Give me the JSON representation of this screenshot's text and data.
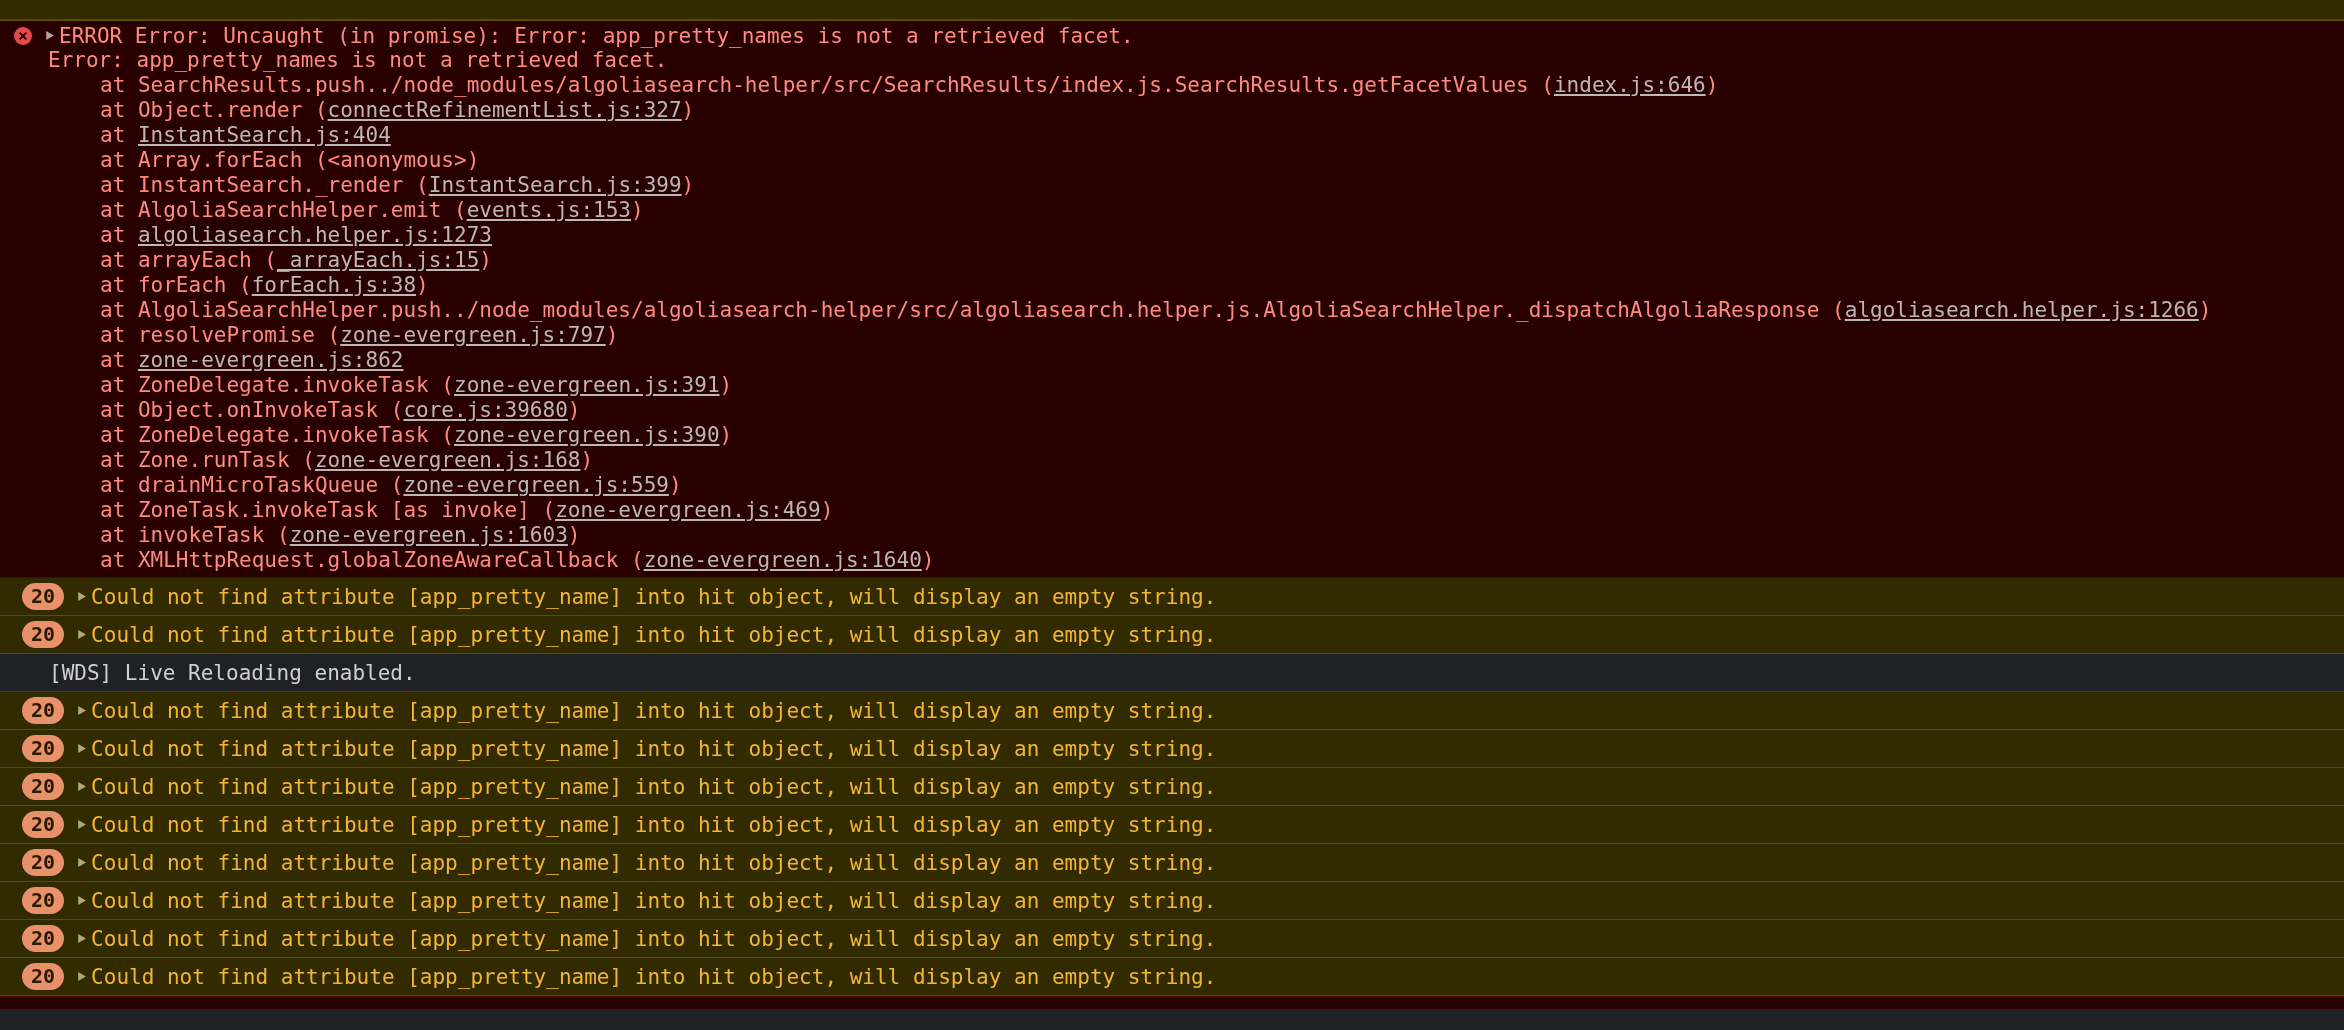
{
  "error": {
    "expanded": false,
    "title": "ERROR Error: Uncaught (in promise): Error: app_pretty_names is not a retrieved facet.",
    "message": "Error: app_pretty_names is not a retrieved facet.",
    "frames": [
      {
        "before": "at SearchResults.push../node_modules/algoliasearch-helper/src/SearchResults/index.js.SearchResults.getFacetValues (",
        "link": "index.js:646",
        "after": ")"
      },
      {
        "before": "at Object.render (",
        "link": "connectRefinementList.js:327",
        "after": ")"
      },
      {
        "before": "at ",
        "link": "InstantSearch.js:404"
      },
      {
        "before": "at Array.forEach (<anonymous>)"
      },
      {
        "before": "at InstantSearch._render (",
        "link": "InstantSearch.js:399",
        "after": ")"
      },
      {
        "before": "at AlgoliaSearchHelper.emit (",
        "link": "events.js:153",
        "after": ")"
      },
      {
        "before": "at ",
        "link": "algoliasearch.helper.js:1273"
      },
      {
        "before": "at arrayEach (",
        "link": "_arrayEach.js:15",
        "after": ")"
      },
      {
        "before": "at forEach (",
        "link": "forEach.js:38",
        "after": ")"
      },
      {
        "before": "at AlgoliaSearchHelper.push../node_modules/algoliasearch-helper/src/algoliasearch.helper.js.AlgoliaSearchHelper._dispatchAlgoliaResponse (",
        "link": "algoliasearch.helper.js:1266",
        "after": ")"
      },
      {
        "before": "at resolvePromise (",
        "link": "zone-evergreen.js:797",
        "after": ")"
      },
      {
        "before": "at ",
        "link": "zone-evergreen.js:862"
      },
      {
        "before": "at ZoneDelegate.invokeTask (",
        "link": "zone-evergreen.js:391",
        "after": ")"
      },
      {
        "before": "at Object.onInvokeTask (",
        "link": "core.js:39680",
        "after": ")"
      },
      {
        "before": "at ZoneDelegate.invokeTask (",
        "link": "zone-evergreen.js:390",
        "after": ")"
      },
      {
        "before": "at Zone.runTask (",
        "link": "zone-evergreen.js:168",
        "after": ")"
      },
      {
        "before": "at drainMicroTaskQueue (",
        "link": "zone-evergreen.js:559",
        "after": ")"
      },
      {
        "before": "at ZoneTask.invokeTask [as invoke] (",
        "link": "zone-evergreen.js:469",
        "after": ")"
      },
      {
        "before": "at invokeTask (",
        "link": "zone-evergreen.js:1603",
        "after": ")"
      },
      {
        "before": "at XMLHttpRequest.globalZoneAwareCallback (",
        "link": "zone-evergreen.js:1640",
        "after": ")"
      }
    ]
  },
  "messages": [
    {
      "kind": "warning",
      "count": "20",
      "expanded": false,
      "text": "Could not find attribute [app_pretty_name] into hit object, will display an empty string."
    },
    {
      "kind": "warning",
      "count": "20",
      "expanded": false,
      "text": "Could not find attribute [app_pretty_name] into hit object, will display an empty string."
    },
    {
      "kind": "info",
      "text": "[WDS] Live Reloading enabled."
    },
    {
      "kind": "warning",
      "count": "20",
      "expanded": false,
      "text": "Could not find attribute [app_pretty_name] into hit object, will display an empty string."
    },
    {
      "kind": "warning",
      "count": "20",
      "expanded": false,
      "text": "Could not find attribute [app_pretty_name] into hit object, will display an empty string."
    },
    {
      "kind": "warning",
      "count": "20",
      "expanded": false,
      "text": "Could not find attribute [app_pretty_name] into hit object, will display an empty string."
    },
    {
      "kind": "warning",
      "count": "20",
      "expanded": false,
      "text": "Could not find attribute [app_pretty_name] into hit object, will display an empty string."
    },
    {
      "kind": "warning",
      "count": "20",
      "expanded": false,
      "text": "Could not find attribute [app_pretty_name] into hit object, will display an empty string."
    },
    {
      "kind": "warning",
      "count": "20",
      "expanded": false,
      "text": "Could not find attribute [app_pretty_name] into hit object, will display an empty string."
    },
    {
      "kind": "warning",
      "count": "20",
      "expanded": false,
      "text": "Could not find attribute [app_pretty_name] into hit object, will display an empty string."
    },
    {
      "kind": "warning",
      "count": "20",
      "expanded": false,
      "text": "Could not find attribute [app_pretty_name] into hit object, will display an empty string."
    }
  ]
}
